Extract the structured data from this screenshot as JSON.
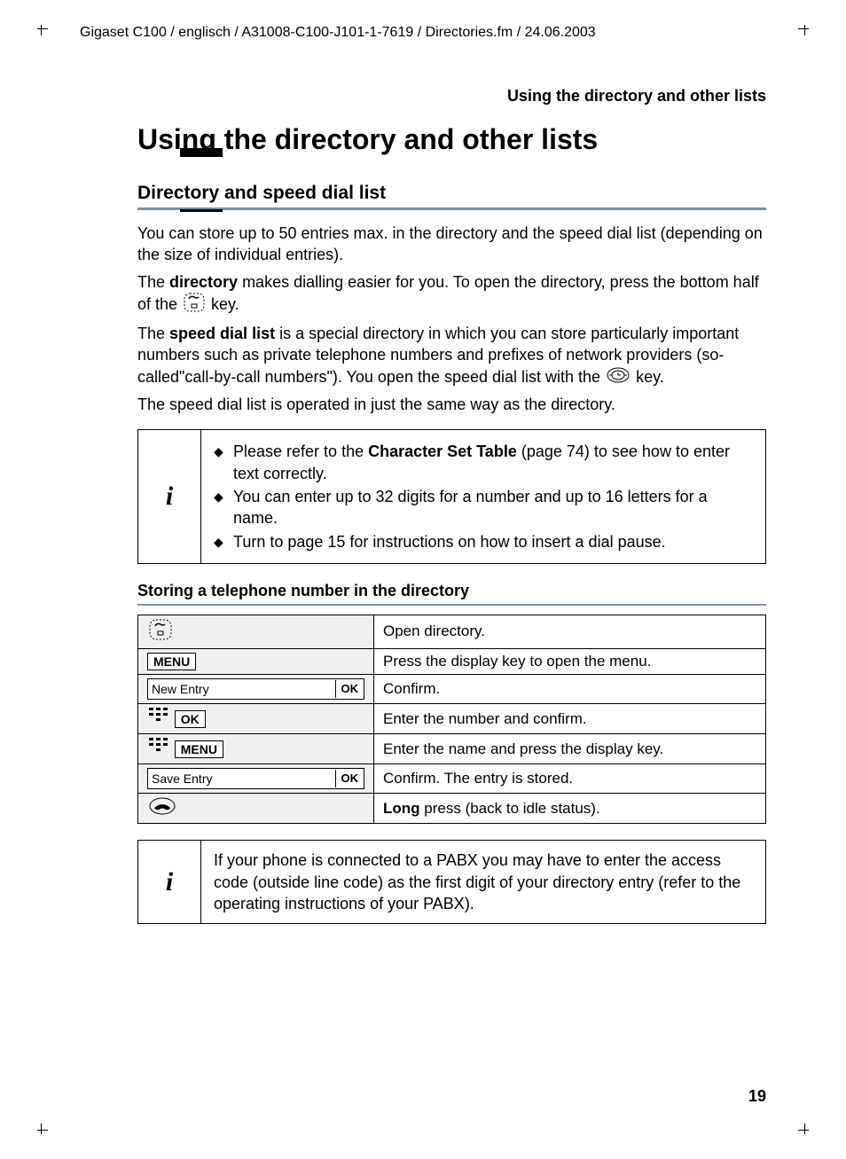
{
  "header_line": "Gigaset C100 / englisch / A31008-C100-J101-1-7619 / Directories.fm / 24.06.2003",
  "running_head": "Using the directory and other lists",
  "title": "Using the directory and other lists",
  "section_heading": "Directory and speed dial list",
  "para1": "You can store up to 50 entries max. in the directory and the speed dial list (depending on the size of individual entries).",
  "para2_pre": "The ",
  "para2_bold": "directory",
  "para2_mid": " makes dialling easier for you. To open the directory, press the bottom half of the ",
  "para2_post": " key.",
  "para3_pre": "The ",
  "para3_bold": "speed dial list",
  "para3_mid": " is a special directory in which you can store particularly important numbers such as private telephone numbers and prefixes of network providers (so-called\"call-by-call numbers\"). You open the speed dial list with the ",
  "para3_post": " key.",
  "para4": "The speed dial list is operated in just the same way as the directory.",
  "info1": {
    "b1_pre": "Please refer to the ",
    "b1_bold": "Character Set Table",
    "b1_post": " (page 74) to see how to enter text correctly.",
    "b2": "You can enter up to 32 digits for a number and up to 16 letters for a name.",
    "b3": "Turn to page 15 for instructions on how to insert a dial pause."
  },
  "sub_heading": "Storing a telephone number in the directory",
  "keys": {
    "menu": "MENU",
    "ok": "OK",
    "new_entry": "New Entry",
    "save_entry": "Save Entry"
  },
  "steps": [
    {
      "action": "Open directory."
    },
    {
      "action": "Press the display key to open the menu."
    },
    {
      "action": "Confirm."
    },
    {
      "action": "Enter the number and confirm."
    },
    {
      "action": "Enter the name and press the display key."
    },
    {
      "action": "Confirm. The entry is stored."
    },
    {
      "action_pre": "Long",
      "action_post": " press (back to idle status)."
    }
  ],
  "info2": "If your phone is connected to a PABX you may have to enter the access code (outside line code) as the first digit of your directory entry (refer to the operating instructions of your PABX).",
  "page_number": "19"
}
